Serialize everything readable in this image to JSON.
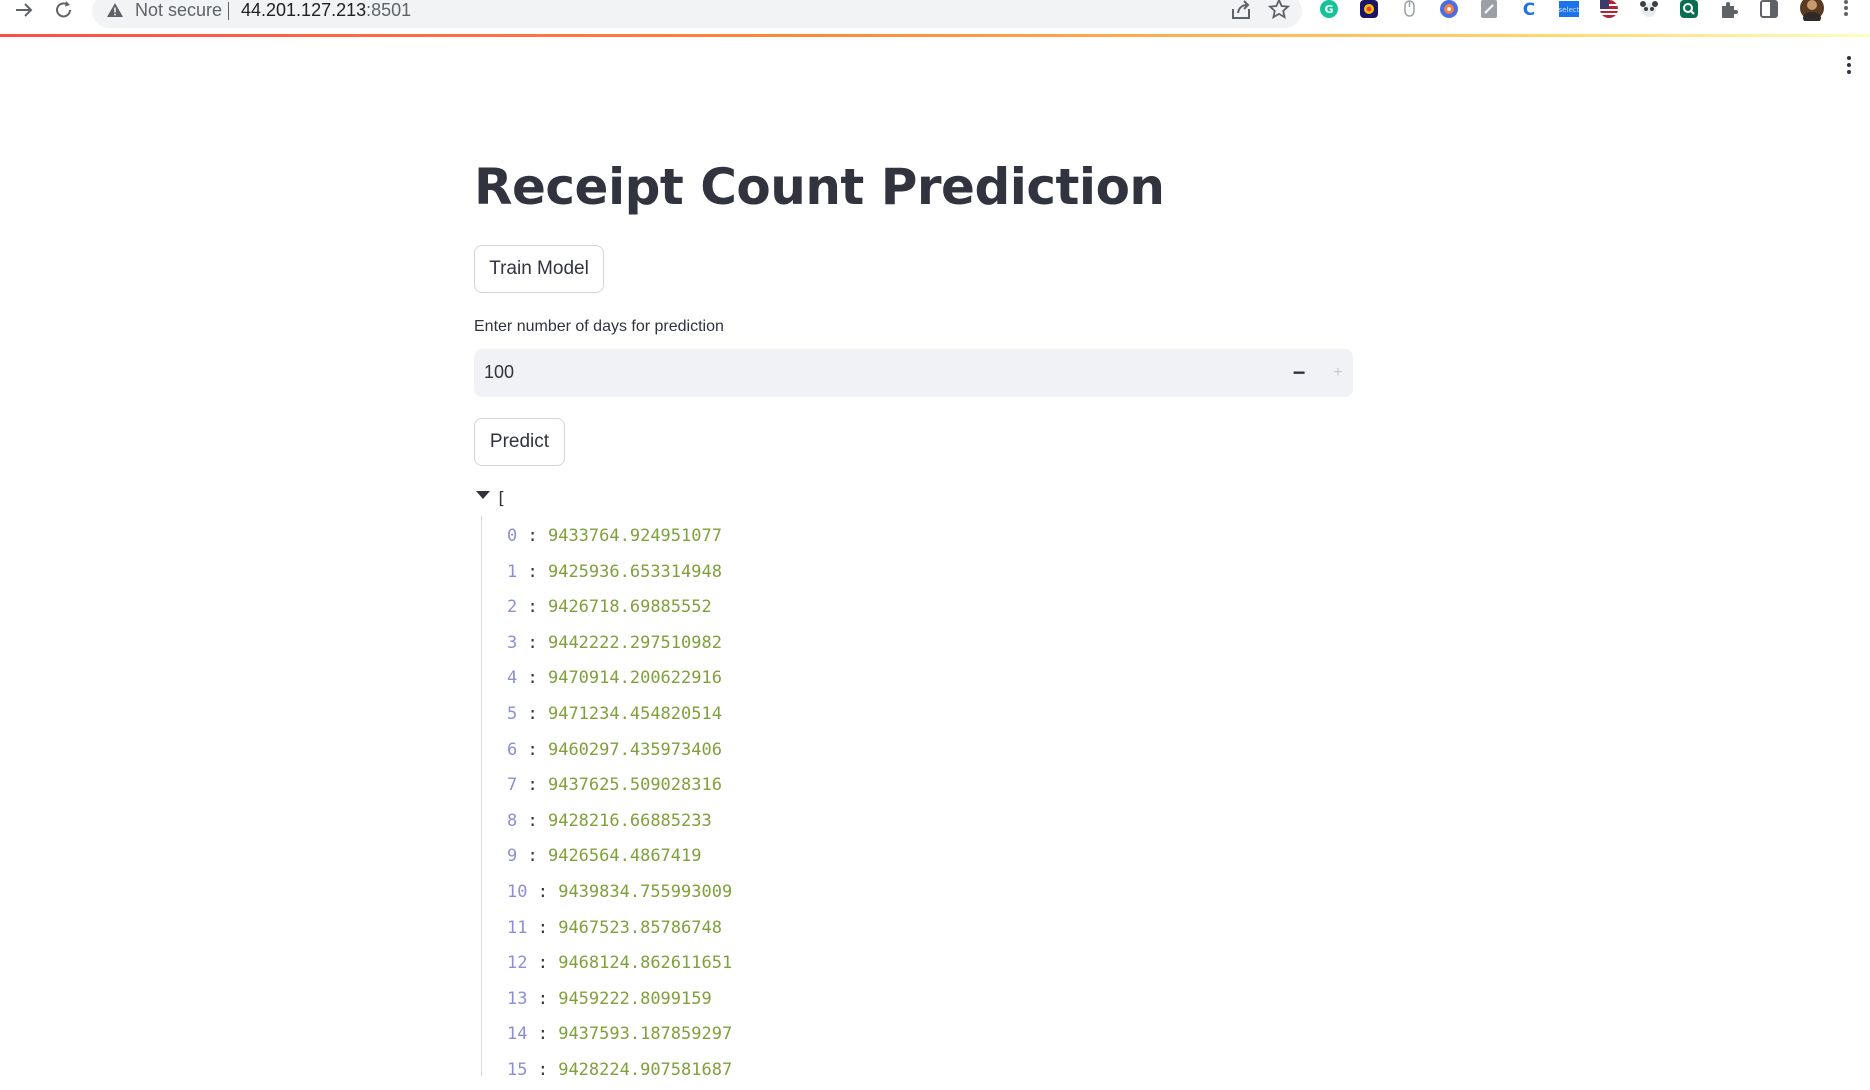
{
  "browser": {
    "security_text": "Not secure",
    "url_host": "44.201.127.213",
    "url_port": ":8501"
  },
  "app": {
    "title": "Receipt Count Prediction",
    "train_button": "Train Model",
    "days_label": "Enter number of days for prediction",
    "days_value": "100",
    "predict_button": "Predict",
    "minus": "−",
    "plus": "+"
  },
  "output": {
    "open_bracket": "[",
    "items": [
      {
        "key": "0",
        "value": "9433764.924951077"
      },
      {
        "key": "1",
        "value": "9425936.653314948"
      },
      {
        "key": "2",
        "value": "9426718.69885552"
      },
      {
        "key": "3",
        "value": "9442222.297510982"
      },
      {
        "key": "4",
        "value": "9470914.200622916"
      },
      {
        "key": "5",
        "value": "9471234.454820514"
      },
      {
        "key": "6",
        "value": "9460297.435973406"
      },
      {
        "key": "7",
        "value": "9437625.509028316"
      },
      {
        "key": "8",
        "value": "9428216.66885233"
      },
      {
        "key": "9",
        "value": "9426564.4867419"
      },
      {
        "key": "10",
        "value": "9439834.755993009"
      },
      {
        "key": "11",
        "value": "9467523.85786748"
      },
      {
        "key": "12",
        "value": "9468124.862611651"
      },
      {
        "key": "13",
        "value": "9459222.8099159"
      },
      {
        "key": "14",
        "value": "9437593.187859297"
      },
      {
        "key": "15",
        "value": "9428224.907581687"
      }
    ]
  },
  "colors": {
    "accent_gradient_start": "#ff4b4b",
    "accent_gradient_end": "#fffdbf",
    "json_key": "#8a8fd6",
    "json_value": "#7fa03a",
    "text": "#31333f"
  }
}
